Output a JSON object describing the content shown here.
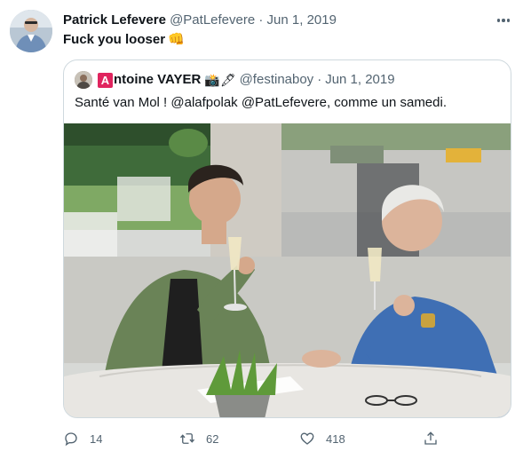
{
  "tweet": {
    "author_name": "Patrick Lefevere",
    "handle": "@PatLefevere",
    "separator": "·",
    "date": "Jun 1, 2019",
    "text": "Fuck you looser",
    "text_emoji": "👊",
    "avatar_icon": "person-avatar"
  },
  "quote": {
    "badge_letter": "A",
    "name_rest": "ntoine VAYER",
    "name_emojis": "📸🖋",
    "handle": "@festinaboy",
    "separator": "·",
    "date": "Jun 1, 2019",
    "text": "Santé van Mol ! @alafpolak @PatLefevere, comme un samedi.",
    "photo_icon": "photo-two-men-toasting-champagne"
  },
  "actions": {
    "reply_count": "14",
    "retweet_count": "62",
    "like_count": "418",
    "share_icon": "share-icon"
  },
  "colors": {
    "text": "#0f1419",
    "muted": "#536471",
    "border": "#cfd9de",
    "badge": "#e0245e"
  }
}
